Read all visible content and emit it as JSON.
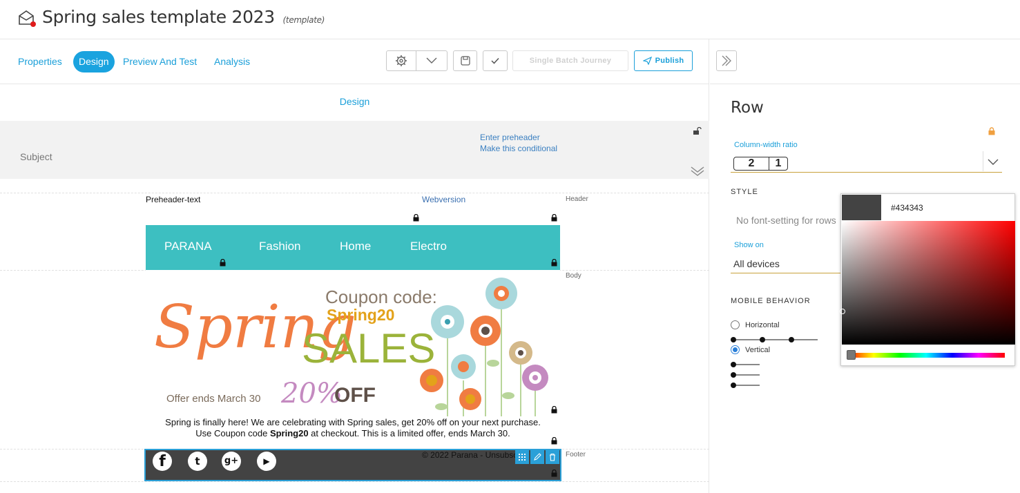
{
  "title_bar": {
    "title": "Spring sales template 2023",
    "tag": "(template)",
    "icon": "envelope-alert-icon"
  },
  "tabs": [
    {
      "label": "Properties",
      "active": false
    },
    {
      "label": "Design",
      "active": true
    },
    {
      "label": "Preview And Test",
      "active": false
    },
    {
      "label": "Analysis",
      "active": false
    }
  ],
  "toolbar": {
    "settings_icon": "gear-icon",
    "dropdown_icon": "chevron-down-icon",
    "save_icon": "save-icon",
    "check_icon": "check-icon",
    "single_batch_label": "Single Batch Journey",
    "publish_label": "Publish",
    "publish_icon": "paper-plane-icon"
  },
  "editor": {
    "section_title": "Design",
    "subject_placeholder": "Subject",
    "enter_preheader": "Enter preheader",
    "make_conditional": "Make this conditional",
    "header_label": "Header",
    "body_label": "Body",
    "footer_label": "Footer",
    "preheader_text": "Preheader-text",
    "webversion": "Webversion",
    "nav": [
      "PARANA",
      "Fashion",
      "Home",
      "Electro"
    ],
    "banner": {
      "spring": "Spring",
      "coupon_code_label": "Coupon code:",
      "coupon_code": "Spring20",
      "sales": "SALES",
      "percent": "20%",
      "off": "OFF",
      "offer_ends": "Offer ends March 30"
    },
    "body_text_line1": "Spring is finally here! We are celebrating with Spring sales, get 20% off on your next purchase.",
    "body_text_line2_pre": "Use Coupon code ",
    "body_text_line2_bold": "Spring20",
    "body_text_line2_post": " at checkout. This is a limited offer, ends March 30.",
    "footer_copy": "© 2022 Parana - Unsubsc",
    "social": [
      "f",
      "t",
      "g+",
      "yt"
    ]
  },
  "panel": {
    "title": "Row",
    "column_ratio_label": "Column-width ratio",
    "ratio_values": [
      "2",
      "1"
    ],
    "style_heading": "STYLE",
    "no_font_setting": "No font-setting for rows",
    "show_on_label": "Show on",
    "show_on_value": "All devices",
    "mobile_behavior_heading": "MOBILE BEHAVIOR",
    "horizontal_label": "Horizontal",
    "vertical_label": "Vertical",
    "selected_behavior": "Vertical"
  },
  "color_picker": {
    "hex": "#434343",
    "swatch_color": "#434343"
  },
  "colors": {
    "accent": "#1aa3df",
    "nav_bg": "#3dbfc1",
    "footer_bg": "#434343",
    "publish": "#1a9fd9"
  }
}
